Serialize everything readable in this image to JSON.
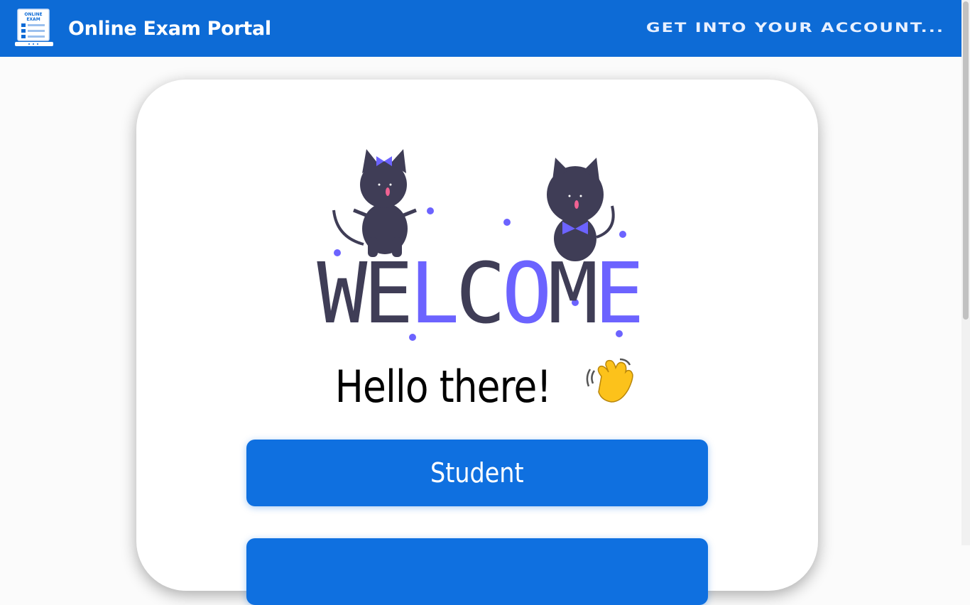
{
  "header": {
    "app_title": "Online Exam Portal",
    "tagline": "Get into your account...",
    "logo_icon": "exam-laptop-icon",
    "logo_text": [
      "ONLINE",
      "EXAM"
    ]
  },
  "welcome": {
    "art_word": "WELCOME",
    "greeting": "Hello there!",
    "greeting_icon": "waving-hand-icon"
  },
  "roles": {
    "buttons": [
      {
        "label": "Student"
      },
      {
        "label": ""
      }
    ]
  },
  "colors": {
    "header_bg": "#0d6bd6",
    "button_bg": "#0f70e0",
    "accent_purple": "#6c63ff",
    "dark_ink": "#3f3d56"
  }
}
